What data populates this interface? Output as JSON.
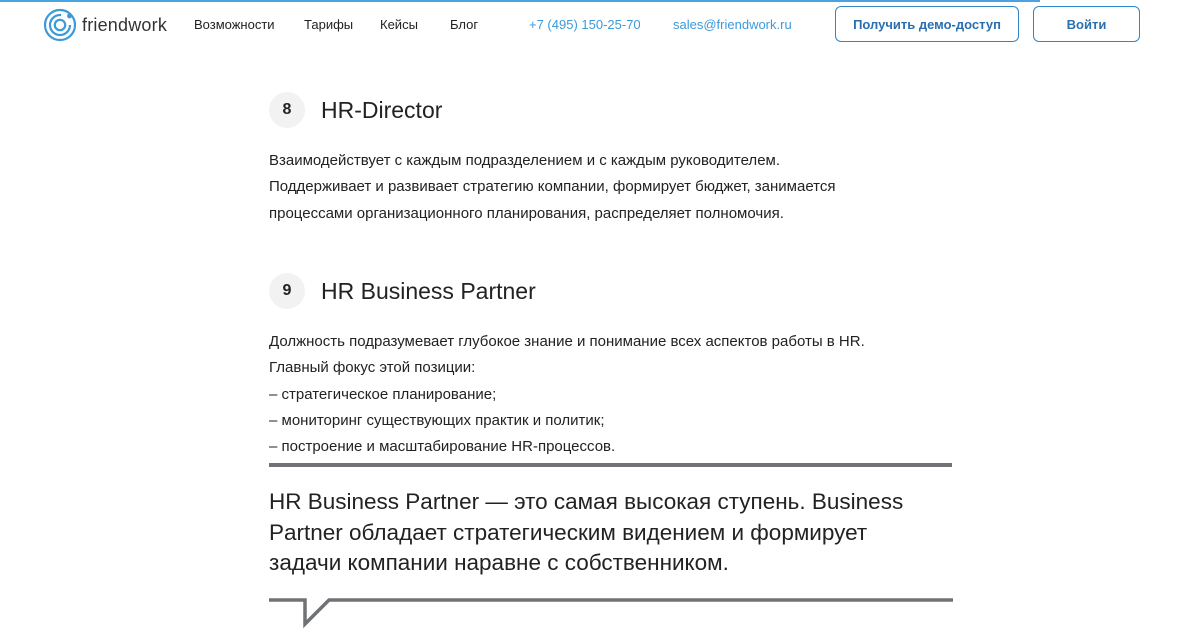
{
  "header": {
    "logo_text": "friendwork",
    "nav": [
      "Возможности",
      "Тарифы",
      "Кейсы",
      "Блог"
    ],
    "phone": "+7 (495) 150-25-70",
    "email": "sales@friendwork.ru",
    "demo_button": "Получить демо-доступ",
    "login_button": "Войти"
  },
  "sections": [
    {
      "number": "8",
      "title": "HR-Director",
      "lines": [
        "Взаимодействует с каждым подразделением и с каждым руководителем.",
        "Поддерживает и развивает стратегию компании, формирует бюджет, занимается",
        "процессами организационного планирования, распределяет полномочия."
      ]
    },
    {
      "number": "9",
      "title": "HR Business Partner",
      "lines": [
        "Должность подразумевает глубокое знание и понимание всех аспектов работы в HR.",
        "Главный фокус этой позиции:",
        "– стратегическое планирование;",
        "– мониторинг существующих практик и политик;",
        "– построение и масштабирование HR-процессов."
      ]
    }
  ],
  "quote": {
    "lines": [
      "HR Business Partner — это самая высокая ступень. Business",
      "Partner обладает стратегическим видением и формирует",
      "задачи компании наравне с собственником."
    ]
  },
  "colors": {
    "accent": "#2f86c9",
    "link": "#3b9ad9",
    "quote_rule": "#707275",
    "badge_bg": "#f2f2f2"
  }
}
